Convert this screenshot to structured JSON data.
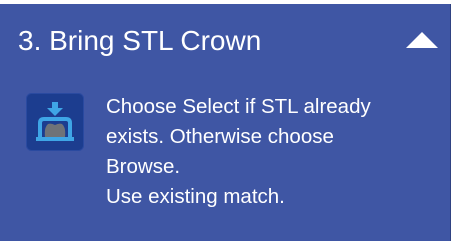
{
  "panel": {
    "title": "3. Bring STL Crown",
    "collapse_icon": "triangle-up-icon",
    "step_icon": "import-crown-icon",
    "description_lines": [
      "Choose Select if STL already",
      "exists. Otherwise choose",
      "Browse.",
      "Use existing match."
    ]
  },
  "colors": {
    "panel_background": "#3f56a4",
    "text": "#ffffff",
    "icon_background": "#1c3d8f",
    "icon_accent": "#3fa6e6",
    "icon_crown": "#6f7378"
  }
}
